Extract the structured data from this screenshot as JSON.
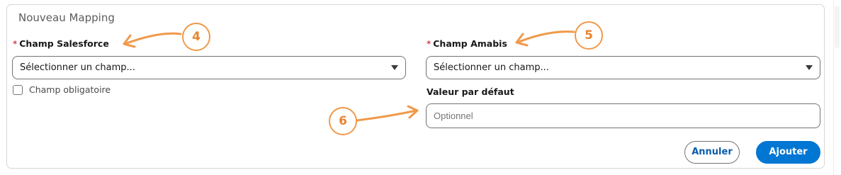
{
  "panel": {
    "title": "Nouveau Mapping"
  },
  "left": {
    "required_mark": "*",
    "label": "Champ Salesforce",
    "select_value": "Sélectionner un champ...",
    "checkbox_label": "Champ obligatoire",
    "checkbox_checked": false
  },
  "right": {
    "required_mark": "*",
    "label": "Champ Amabis",
    "select_value": "Sélectionner un champ...",
    "default_label": "Valeur par défaut",
    "default_placeholder": "Optionnel"
  },
  "buttons": {
    "cancel": "Annuler",
    "submit": "Ajouter"
  },
  "annotations": {
    "badge_4": "4",
    "badge_5": "5",
    "badge_6": "6",
    "color": "#f0994a"
  },
  "colors": {
    "accent": "#0176d3",
    "required": "#ba0517"
  }
}
